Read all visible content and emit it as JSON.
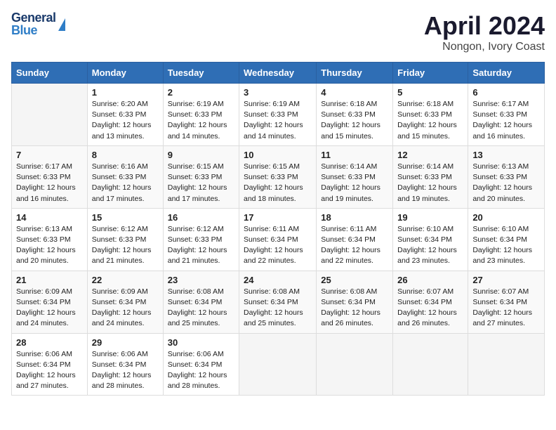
{
  "header": {
    "logo_general": "General",
    "logo_blue": "Blue",
    "title": "April 2024",
    "subtitle": "Nongon, Ivory Coast"
  },
  "days_of_week": [
    "Sunday",
    "Monday",
    "Tuesday",
    "Wednesday",
    "Thursday",
    "Friday",
    "Saturday"
  ],
  "weeks": [
    [
      {
        "num": "",
        "text": ""
      },
      {
        "num": "1",
        "text": "Sunrise: 6:20 AM\nSunset: 6:33 PM\nDaylight: 12 hours\nand 13 minutes."
      },
      {
        "num": "2",
        "text": "Sunrise: 6:19 AM\nSunset: 6:33 PM\nDaylight: 12 hours\nand 14 minutes."
      },
      {
        "num": "3",
        "text": "Sunrise: 6:19 AM\nSunset: 6:33 PM\nDaylight: 12 hours\nand 14 minutes."
      },
      {
        "num": "4",
        "text": "Sunrise: 6:18 AM\nSunset: 6:33 PM\nDaylight: 12 hours\nand 15 minutes."
      },
      {
        "num": "5",
        "text": "Sunrise: 6:18 AM\nSunset: 6:33 PM\nDaylight: 12 hours\nand 15 minutes."
      },
      {
        "num": "6",
        "text": "Sunrise: 6:17 AM\nSunset: 6:33 PM\nDaylight: 12 hours\nand 16 minutes."
      }
    ],
    [
      {
        "num": "7",
        "text": "Sunrise: 6:17 AM\nSunset: 6:33 PM\nDaylight: 12 hours\nand 16 minutes."
      },
      {
        "num": "8",
        "text": "Sunrise: 6:16 AM\nSunset: 6:33 PM\nDaylight: 12 hours\nand 17 minutes."
      },
      {
        "num": "9",
        "text": "Sunrise: 6:15 AM\nSunset: 6:33 PM\nDaylight: 12 hours\nand 17 minutes."
      },
      {
        "num": "10",
        "text": "Sunrise: 6:15 AM\nSunset: 6:33 PM\nDaylight: 12 hours\nand 18 minutes."
      },
      {
        "num": "11",
        "text": "Sunrise: 6:14 AM\nSunset: 6:33 PM\nDaylight: 12 hours\nand 19 minutes."
      },
      {
        "num": "12",
        "text": "Sunrise: 6:14 AM\nSunset: 6:33 PM\nDaylight: 12 hours\nand 19 minutes."
      },
      {
        "num": "13",
        "text": "Sunrise: 6:13 AM\nSunset: 6:33 PM\nDaylight: 12 hours\nand 20 minutes."
      }
    ],
    [
      {
        "num": "14",
        "text": "Sunrise: 6:13 AM\nSunset: 6:33 PM\nDaylight: 12 hours\nand 20 minutes."
      },
      {
        "num": "15",
        "text": "Sunrise: 6:12 AM\nSunset: 6:33 PM\nDaylight: 12 hours\nand 21 minutes."
      },
      {
        "num": "16",
        "text": "Sunrise: 6:12 AM\nSunset: 6:33 PM\nDaylight: 12 hours\nand 21 minutes."
      },
      {
        "num": "17",
        "text": "Sunrise: 6:11 AM\nSunset: 6:34 PM\nDaylight: 12 hours\nand 22 minutes."
      },
      {
        "num": "18",
        "text": "Sunrise: 6:11 AM\nSunset: 6:34 PM\nDaylight: 12 hours\nand 22 minutes."
      },
      {
        "num": "19",
        "text": "Sunrise: 6:10 AM\nSunset: 6:34 PM\nDaylight: 12 hours\nand 23 minutes."
      },
      {
        "num": "20",
        "text": "Sunrise: 6:10 AM\nSunset: 6:34 PM\nDaylight: 12 hours\nand 23 minutes."
      }
    ],
    [
      {
        "num": "21",
        "text": "Sunrise: 6:09 AM\nSunset: 6:34 PM\nDaylight: 12 hours\nand 24 minutes."
      },
      {
        "num": "22",
        "text": "Sunrise: 6:09 AM\nSunset: 6:34 PM\nDaylight: 12 hours\nand 24 minutes."
      },
      {
        "num": "23",
        "text": "Sunrise: 6:08 AM\nSunset: 6:34 PM\nDaylight: 12 hours\nand 25 minutes."
      },
      {
        "num": "24",
        "text": "Sunrise: 6:08 AM\nSunset: 6:34 PM\nDaylight: 12 hours\nand 25 minutes."
      },
      {
        "num": "25",
        "text": "Sunrise: 6:08 AM\nSunset: 6:34 PM\nDaylight: 12 hours\nand 26 minutes."
      },
      {
        "num": "26",
        "text": "Sunrise: 6:07 AM\nSunset: 6:34 PM\nDaylight: 12 hours\nand 26 minutes."
      },
      {
        "num": "27",
        "text": "Sunrise: 6:07 AM\nSunset: 6:34 PM\nDaylight: 12 hours\nand 27 minutes."
      }
    ],
    [
      {
        "num": "28",
        "text": "Sunrise: 6:06 AM\nSunset: 6:34 PM\nDaylight: 12 hours\nand 27 minutes."
      },
      {
        "num": "29",
        "text": "Sunrise: 6:06 AM\nSunset: 6:34 PM\nDaylight: 12 hours\nand 28 minutes."
      },
      {
        "num": "30",
        "text": "Sunrise: 6:06 AM\nSunset: 6:34 PM\nDaylight: 12 hours\nand 28 minutes."
      },
      {
        "num": "",
        "text": ""
      },
      {
        "num": "",
        "text": ""
      },
      {
        "num": "",
        "text": ""
      },
      {
        "num": "",
        "text": ""
      }
    ]
  ]
}
